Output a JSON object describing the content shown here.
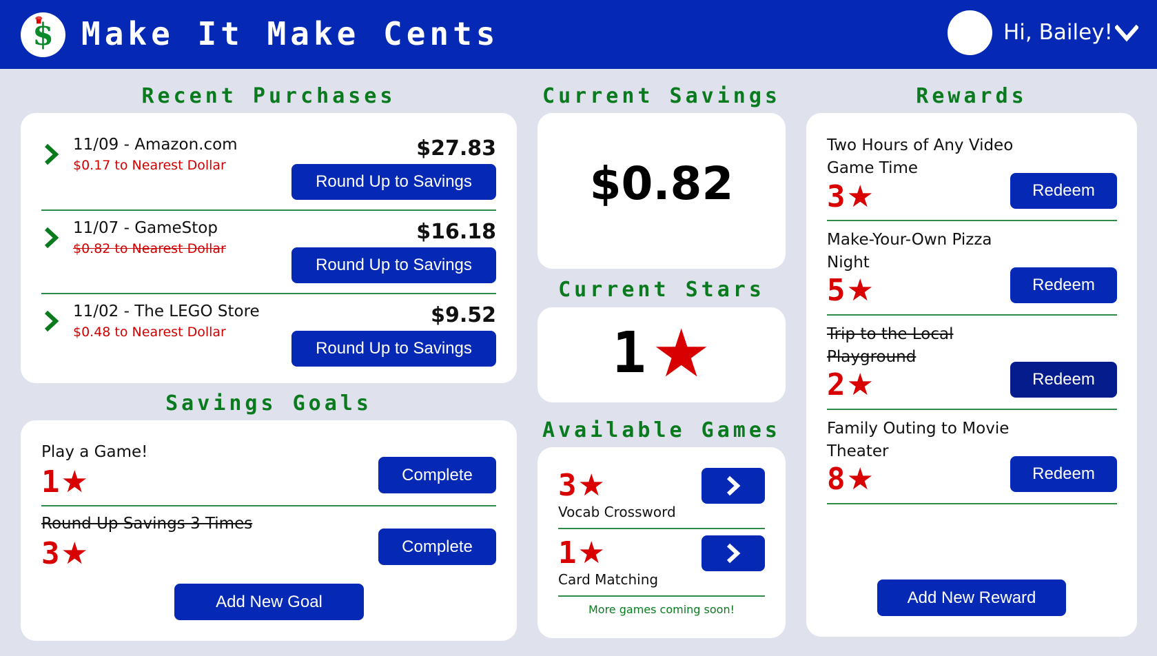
{
  "header": {
    "logo_symbol": "$",
    "logo_crown": "♛",
    "app_title": "Make It Make Cents",
    "greeting": "Hi, Bailey!"
  },
  "colors": {
    "header_bg": "#0529b5",
    "page_bg": "#dfe1ed",
    "accent_green": "#0a7a1f",
    "accent_red": "#d80000",
    "button_blue": "#0529b5"
  },
  "purchases": {
    "title": "Recent Purchases",
    "button_label": "Round Up to Savings",
    "items": [
      {
        "title": "11/09 - Amazon.com",
        "sub": "$0.17 to Nearest Dollar",
        "amount": "$27.83",
        "completed": false
      },
      {
        "title": "11/07 - GameStop",
        "sub": "$0.82 to Nearest Dollar",
        "amount": "$16.18",
        "completed": true
      },
      {
        "title": "11/02 - The LEGO Store",
        "sub": "$0.48 to Nearest Dollar",
        "amount": "$9.52",
        "completed": false
      }
    ]
  },
  "goals": {
    "title": "Savings Goals",
    "button_label": "Complete",
    "add_label": "Add New Goal",
    "items": [
      {
        "title": "Play a Game!",
        "stars": "1",
        "completed": false
      },
      {
        "title": "Round Up Savings 3 Times",
        "stars": "3",
        "completed": true
      }
    ]
  },
  "savings": {
    "title": "Current Savings",
    "amount": "$0.82"
  },
  "stars": {
    "title": "Current Stars",
    "count": "1",
    "star_glyph": "★"
  },
  "games": {
    "title": "Available Games",
    "items": [
      {
        "name": "Vocab Crossword",
        "stars": "3"
      },
      {
        "name": "Card Matching",
        "stars": "1"
      }
    ],
    "footer": "More games coming soon!"
  },
  "rewards": {
    "title": "Rewards",
    "button_label": "Redeem",
    "add_label": "Add New Reward",
    "items": [
      {
        "title": "Two Hours of Any Video Game Time",
        "stars": "3",
        "completed": false
      },
      {
        "title": "Make-Your-Own Pizza Night",
        "stars": "5",
        "completed": false
      },
      {
        "title": "Trip to the Local Playground",
        "stars": "2",
        "completed": true
      },
      {
        "title": "Family Outing to Movie Theater",
        "stars": "8",
        "completed": false
      }
    ]
  }
}
